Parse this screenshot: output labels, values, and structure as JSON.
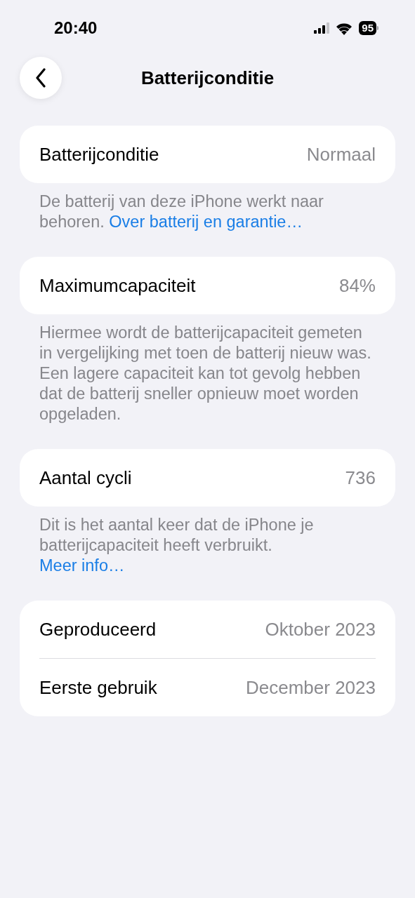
{
  "status_bar": {
    "time": "20:40",
    "battery": "95"
  },
  "nav": {
    "title": "Batterijconditie"
  },
  "sections": [
    {
      "rows": [
        {
          "label": "Batterijconditie",
          "value": "Normaal"
        }
      ],
      "footer": {
        "text": "De batterij van deze iPhone werkt naar behoren.",
        "link": "Over batterij en garantie…",
        "link_on_new_line": false
      }
    },
    {
      "rows": [
        {
          "label": "Maximumcapaciteit",
          "value": "84%"
        }
      ],
      "footer": {
        "text": "Hiermee wordt de batterijcapaciteit gemeten in vergelijking met toen de batterij nieuw was. Een lagere capaciteit kan tot gevolg hebben dat de batterij sneller opnieuw moet worden opgeladen."
      }
    },
    {
      "rows": [
        {
          "label": "Aantal cycli",
          "value": "736"
        }
      ],
      "footer": {
        "text": "Dit is het aantal keer dat de iPhone je batterijcapaciteit heeft verbruikt.",
        "link": "Meer info…",
        "link_on_new_line": true
      }
    },
    {
      "rows": [
        {
          "label": "Geproduceerd",
          "value": "Oktober 2023"
        },
        {
          "label": "Eerste gebruik",
          "value": "December 2023"
        }
      ]
    }
  ]
}
